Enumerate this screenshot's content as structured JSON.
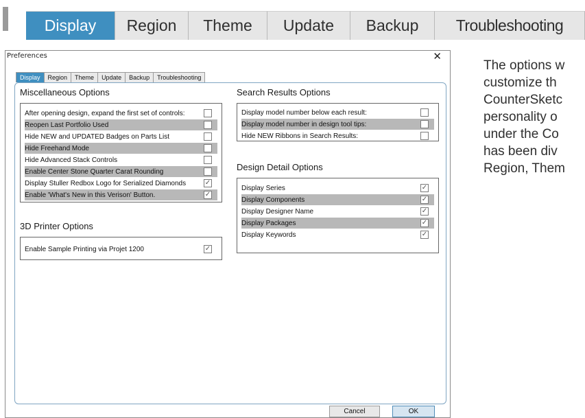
{
  "top_tabs": [
    "Display",
    "Region",
    "Theme",
    "Update",
    "Backup",
    "Troubleshooting"
  ],
  "dialog": {
    "title": "Preferences",
    "close_glyph": "✕",
    "tabs": [
      "Display",
      "Region",
      "Theme",
      "Update",
      "Backup",
      "Troubleshooting"
    ],
    "misc": {
      "title": "Miscellaneous Options",
      "rows": [
        {
          "label": "After opening design, expand the first set of controls:",
          "checked": false,
          "highlight": false
        },
        {
          "label": "Reopen Last Portfolio Used",
          "checked": false,
          "highlight": true
        },
        {
          "label": "Hide NEW and UPDATED Badges on Parts List",
          "checked": false,
          "highlight": false
        },
        {
          "label": "Hide Freehand Mode",
          "checked": false,
          "highlight": true
        },
        {
          "label": "Hide Advanced Stack Controls",
          "checked": false,
          "highlight": false
        },
        {
          "label": "Enable Center Stone Quarter Carat Rounding",
          "checked": false,
          "highlight": true
        },
        {
          "label": "Display Stuller Redbox Logo for Serialized Diamonds",
          "checked": true,
          "highlight": false
        },
        {
          "label": "Enable 'What's New in this Verison' Button.",
          "checked": true,
          "highlight": true
        }
      ]
    },
    "printer": {
      "title": "3D Printer Options",
      "rows": [
        {
          "label": "Enable Sample Printing via Projet 1200",
          "checked": true,
          "highlight": false
        }
      ]
    },
    "search": {
      "title": "Search Results Options",
      "rows": [
        {
          "label": "Display model number below each result:",
          "checked": false,
          "highlight": false
        },
        {
          "label": "Display model number in design tool tips:",
          "checked": false,
          "highlight": true
        },
        {
          "label": "Hide NEW Ribbons in Search Results:",
          "checked": false,
          "highlight": false
        }
      ]
    },
    "detail": {
      "title": "Design Detail Options",
      "rows": [
        {
          "label": "Display Series",
          "checked": true,
          "highlight": false
        },
        {
          "label": "Display Components",
          "checked": true,
          "highlight": true
        },
        {
          "label": "Display Designer Name",
          "checked": true,
          "highlight": false
        },
        {
          "label": "Display Packages",
          "checked": true,
          "highlight": true
        },
        {
          "label": "Display Keywords",
          "checked": true,
          "highlight": false
        }
      ]
    },
    "cancel_label": "Cancel",
    "ok_label": "OK"
  },
  "side_text": [
    "The options w",
    "customize th",
    "CounterSketc",
    "personality o",
    "under the Co",
    "has been div",
    "Region, Them"
  ],
  "colors": {
    "accent": "#3f8fc0",
    "highlight_row": "#b8b8b8",
    "panel_border": "#7fa5c2"
  }
}
